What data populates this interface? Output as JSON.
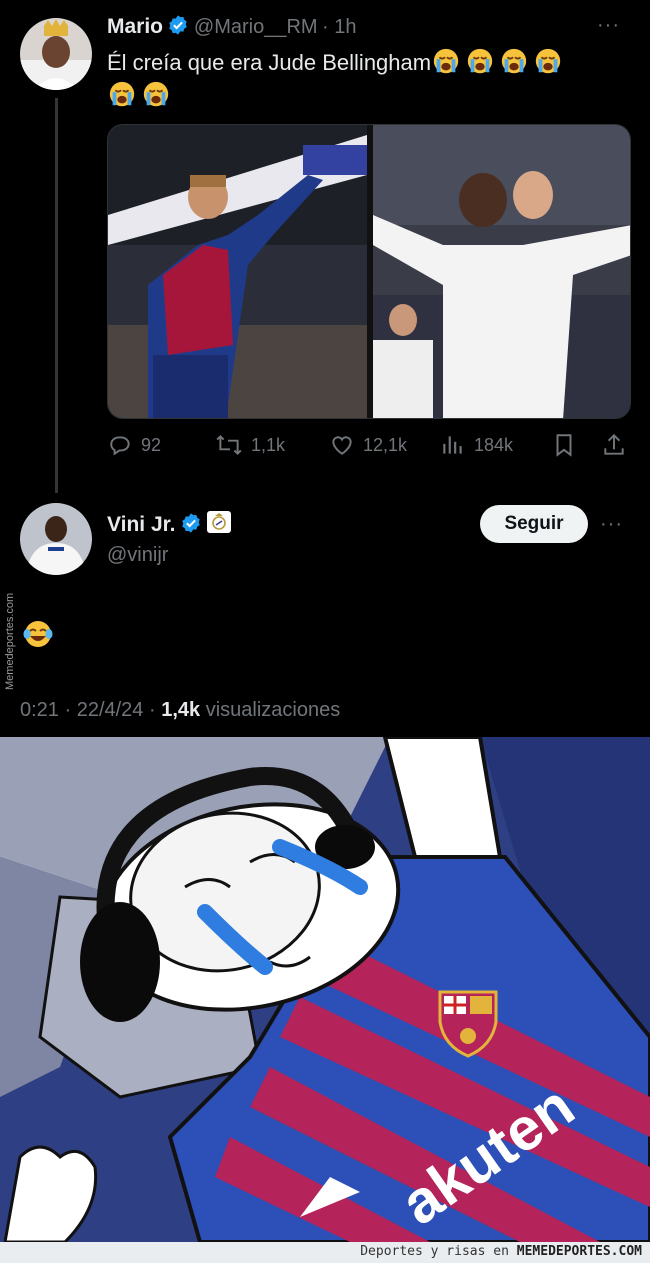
{
  "tweet1": {
    "name": "Mario",
    "handle": "@Mario__RM",
    "time": "· 1h",
    "text": "Él creía que era Jude Bellingham",
    "emoji_icon": "loudly-crying-face-icon",
    "emoji_count": 6,
    "stats": {
      "replies": "92",
      "retweets": "1,1k",
      "likes": "12,1k",
      "views": "184k"
    }
  },
  "tweet2": {
    "name": "Vini Jr.",
    "handle": "@vinijr",
    "follow_label": "Seguir",
    "text_emoji_icon": "face-with-tears-of-joy-icon",
    "meta_time": "0:21 · 22/4/24 ·",
    "meta_views_count": "1,4k",
    "meta_views_label": "visualizaciones"
  },
  "watermark_side": "Memedeportes.com",
  "footer": {
    "prefix": "Deportes y risas en",
    "brand": "MEMEDEPORTES.COM"
  },
  "colors": {
    "background": "#000000",
    "text": "#e7e9ea",
    "muted": "#71767b",
    "verified": "#1d9bf0",
    "follow_button_bg": "#eff3f4"
  }
}
